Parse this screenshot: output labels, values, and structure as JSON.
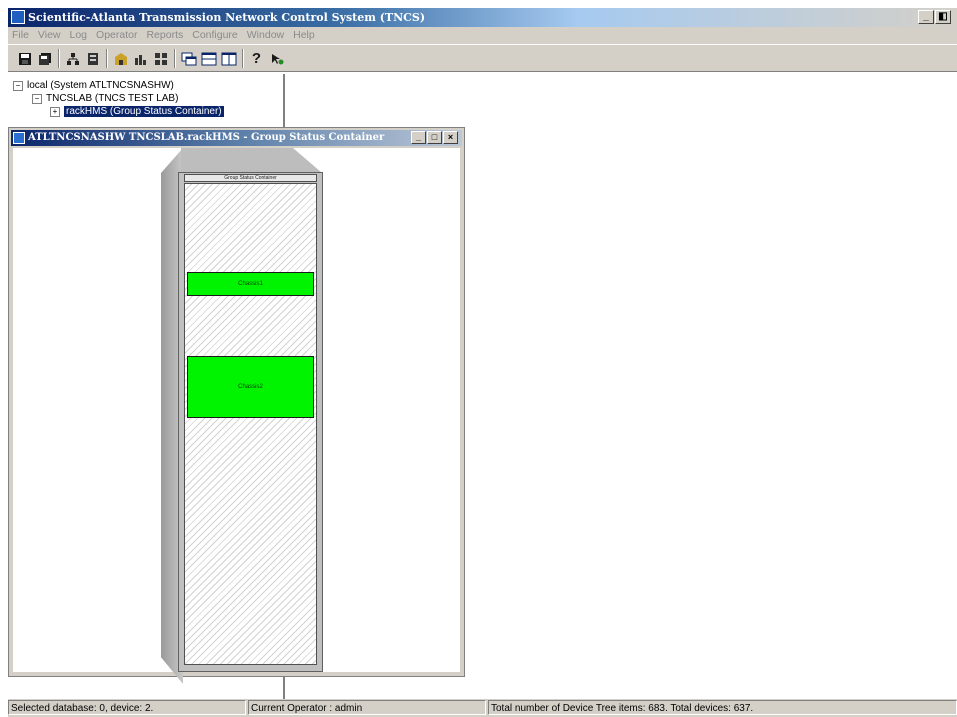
{
  "window": {
    "title": "Scientific-Atlanta Transmission Network Control System (TNCS)",
    "minimize": "_",
    "restore": "◧"
  },
  "menu": [
    "File",
    "View",
    "Log",
    "Operator",
    "Reports",
    "Configure",
    "Window",
    "Help"
  ],
  "toolbar": {
    "icons": [
      "save-icon",
      "save-all-icon",
      "network-icon",
      "device-icon",
      "building-icon",
      "chart-icon",
      "group-icon",
      "cascade-icon",
      "tile-horizontal-icon",
      "tile-vertical-icon",
      "help-icon",
      "context-help-icon"
    ],
    "help_label": "?"
  },
  "tree": {
    "root": "local (System ATLTNCSNASHW)",
    "child": "TNCSLAB (TNCS TEST LAB)",
    "selected": "rackHMS (Group Status Container)",
    "expand_minus": "−",
    "expand_plus": "+"
  },
  "child_window": {
    "title": "ATLTNCSNASHW TNCSLAB.rackHMS - Group Status Container",
    "minimize": "_",
    "maximize": "□",
    "close": "×"
  },
  "rack": {
    "label": "Group Status Container",
    "chassis": [
      {
        "label": "Chassis1",
        "color": "#00f400"
      },
      {
        "label": "Chassis2",
        "color": "#00f400"
      }
    ]
  },
  "status": {
    "database": "Selected database: 0, device: 2.",
    "operator": "Current Operator : admin",
    "totals": "Total number of Device Tree items: 683. Total devices: 637."
  }
}
